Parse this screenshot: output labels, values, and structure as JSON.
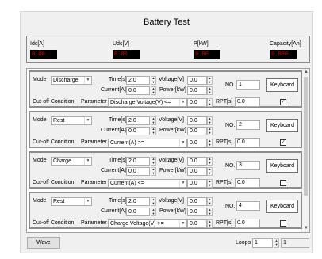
{
  "title": "Battery Test",
  "measurements": [
    {
      "label": "Idc[A]",
      "value": "0.00"
    },
    {
      "label": "Udc[V]",
      "value": "0.00"
    },
    {
      "label": "P[kW]",
      "value": "0.00"
    },
    {
      "label": "Capacity[Ah]",
      "value": "0.000"
    }
  ],
  "labels": {
    "mode": "Mode",
    "time": "Time[s]",
    "voltage": "Voltage[V]",
    "current": "Current[A]",
    "power": "Power[kW]",
    "no": "NO.",
    "cutoff": "Cut-off Condition",
    "parameter": "Parameter",
    "rpt": "RPT[s]",
    "keyboard": "Keyboard"
  },
  "steps": [
    {
      "mode": "Discharge",
      "time": "2.0",
      "current": "0.0",
      "voltage": "0.0",
      "power": "0.0",
      "no": "1",
      "parameter": "Discharge Voltage(V) <=",
      "cutoff_value": "0.0",
      "rpt": "0.0",
      "checked": true
    },
    {
      "mode": "Rest",
      "time": "2.0",
      "current": "0.0",
      "voltage": "0.0",
      "power": "0.0",
      "no": "2",
      "parameter": "Current(A)  >=",
      "cutoff_value": "0.0",
      "rpt": "0.0",
      "checked": true
    },
    {
      "mode": "Charge",
      "time": "2.0",
      "current": "0.0",
      "voltage": "0.0",
      "power": "0.0",
      "no": "3",
      "parameter": "Current(A)  <=",
      "cutoff_value": "0.0",
      "rpt": "0.0",
      "checked": false
    },
    {
      "mode": "Rest",
      "time": "2.0",
      "current": "0.0",
      "voltage": "0.0",
      "power": "0.0",
      "no": "4",
      "parameter": "Charge Voltage(V) >=",
      "cutoff_value": "0.0",
      "rpt": "0.0",
      "checked": false
    }
  ],
  "footer": {
    "wave": "Wave",
    "loops_label": "Loops",
    "loops_value": "1",
    "loops_count": "1"
  },
  "icons": {
    "checkmark": "check-icon",
    "dropdown": "chevron-down-icon",
    "spinner": "spin-arrows-icon",
    "scroll_up": "scroll-up-icon",
    "scroll_down": "scroll-down-icon"
  },
  "colors": {
    "display_bg": "#000000",
    "display_text": "#cc0000",
    "panel_bg": "#f0f0f0",
    "step_border": "#8c8c8c"
  }
}
